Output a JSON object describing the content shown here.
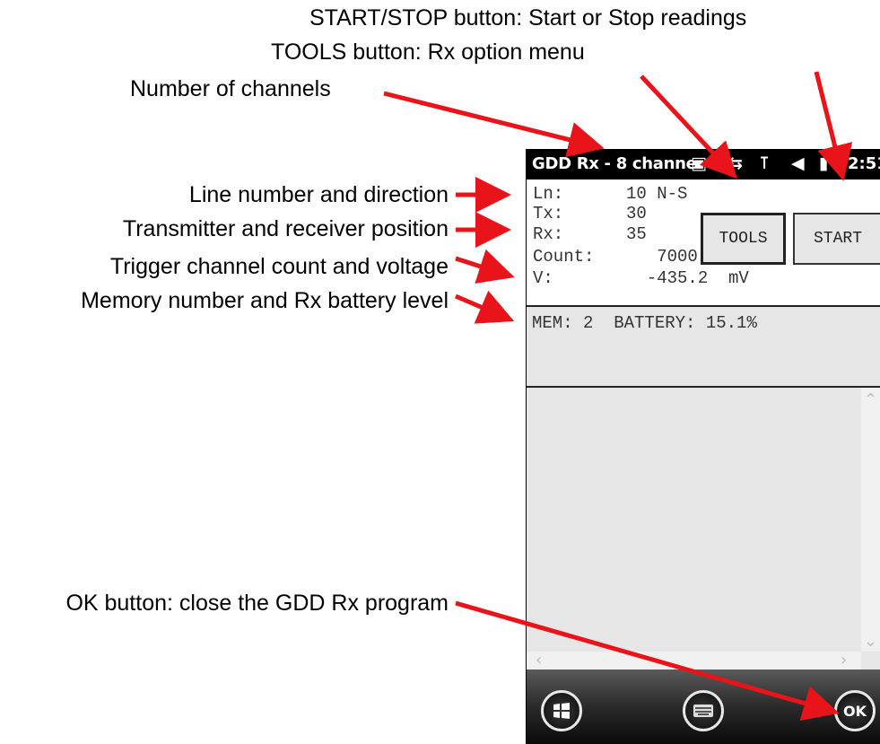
{
  "callouts": {
    "start_stop": "START/STOP button: Start or Stop readings",
    "tools": "TOOLS button: Rx option menu",
    "channels": "Number of channels",
    "line": "Line number and direction",
    "position": "Transmitter and receiver position",
    "trigger": "Trigger channel count and voltage",
    "memory": "Memory number and Rx battery level",
    "ok": "OK button: close the GDD Rx program"
  },
  "statusbar": {
    "title": "GDD Rx - 8 channe",
    "time": "2:51",
    "icons": [
      "message-icon",
      "sync-icon",
      "no-signal-icon",
      "speaker-icon",
      "battery-icon"
    ]
  },
  "info": {
    "ln_label": "Ln:",
    "ln_value": "10 N-S",
    "tx_label": "Tx:",
    "tx_value": "30",
    "rx_label": "Rx:",
    "rx_value": "35",
    "count_label": "Count:",
    "count_value": "   7000",
    "v_label": "V:",
    "v_value": "  -435.2  mV"
  },
  "buttons": {
    "tools": "TOOLS",
    "start": "START"
  },
  "memory_line": "MEM: 2  BATTERY: 15.1%",
  "taskbar": {
    "ok": "OK"
  },
  "colors": {
    "arrow": "#e8141a",
    "panel": "#e6e6e6"
  }
}
